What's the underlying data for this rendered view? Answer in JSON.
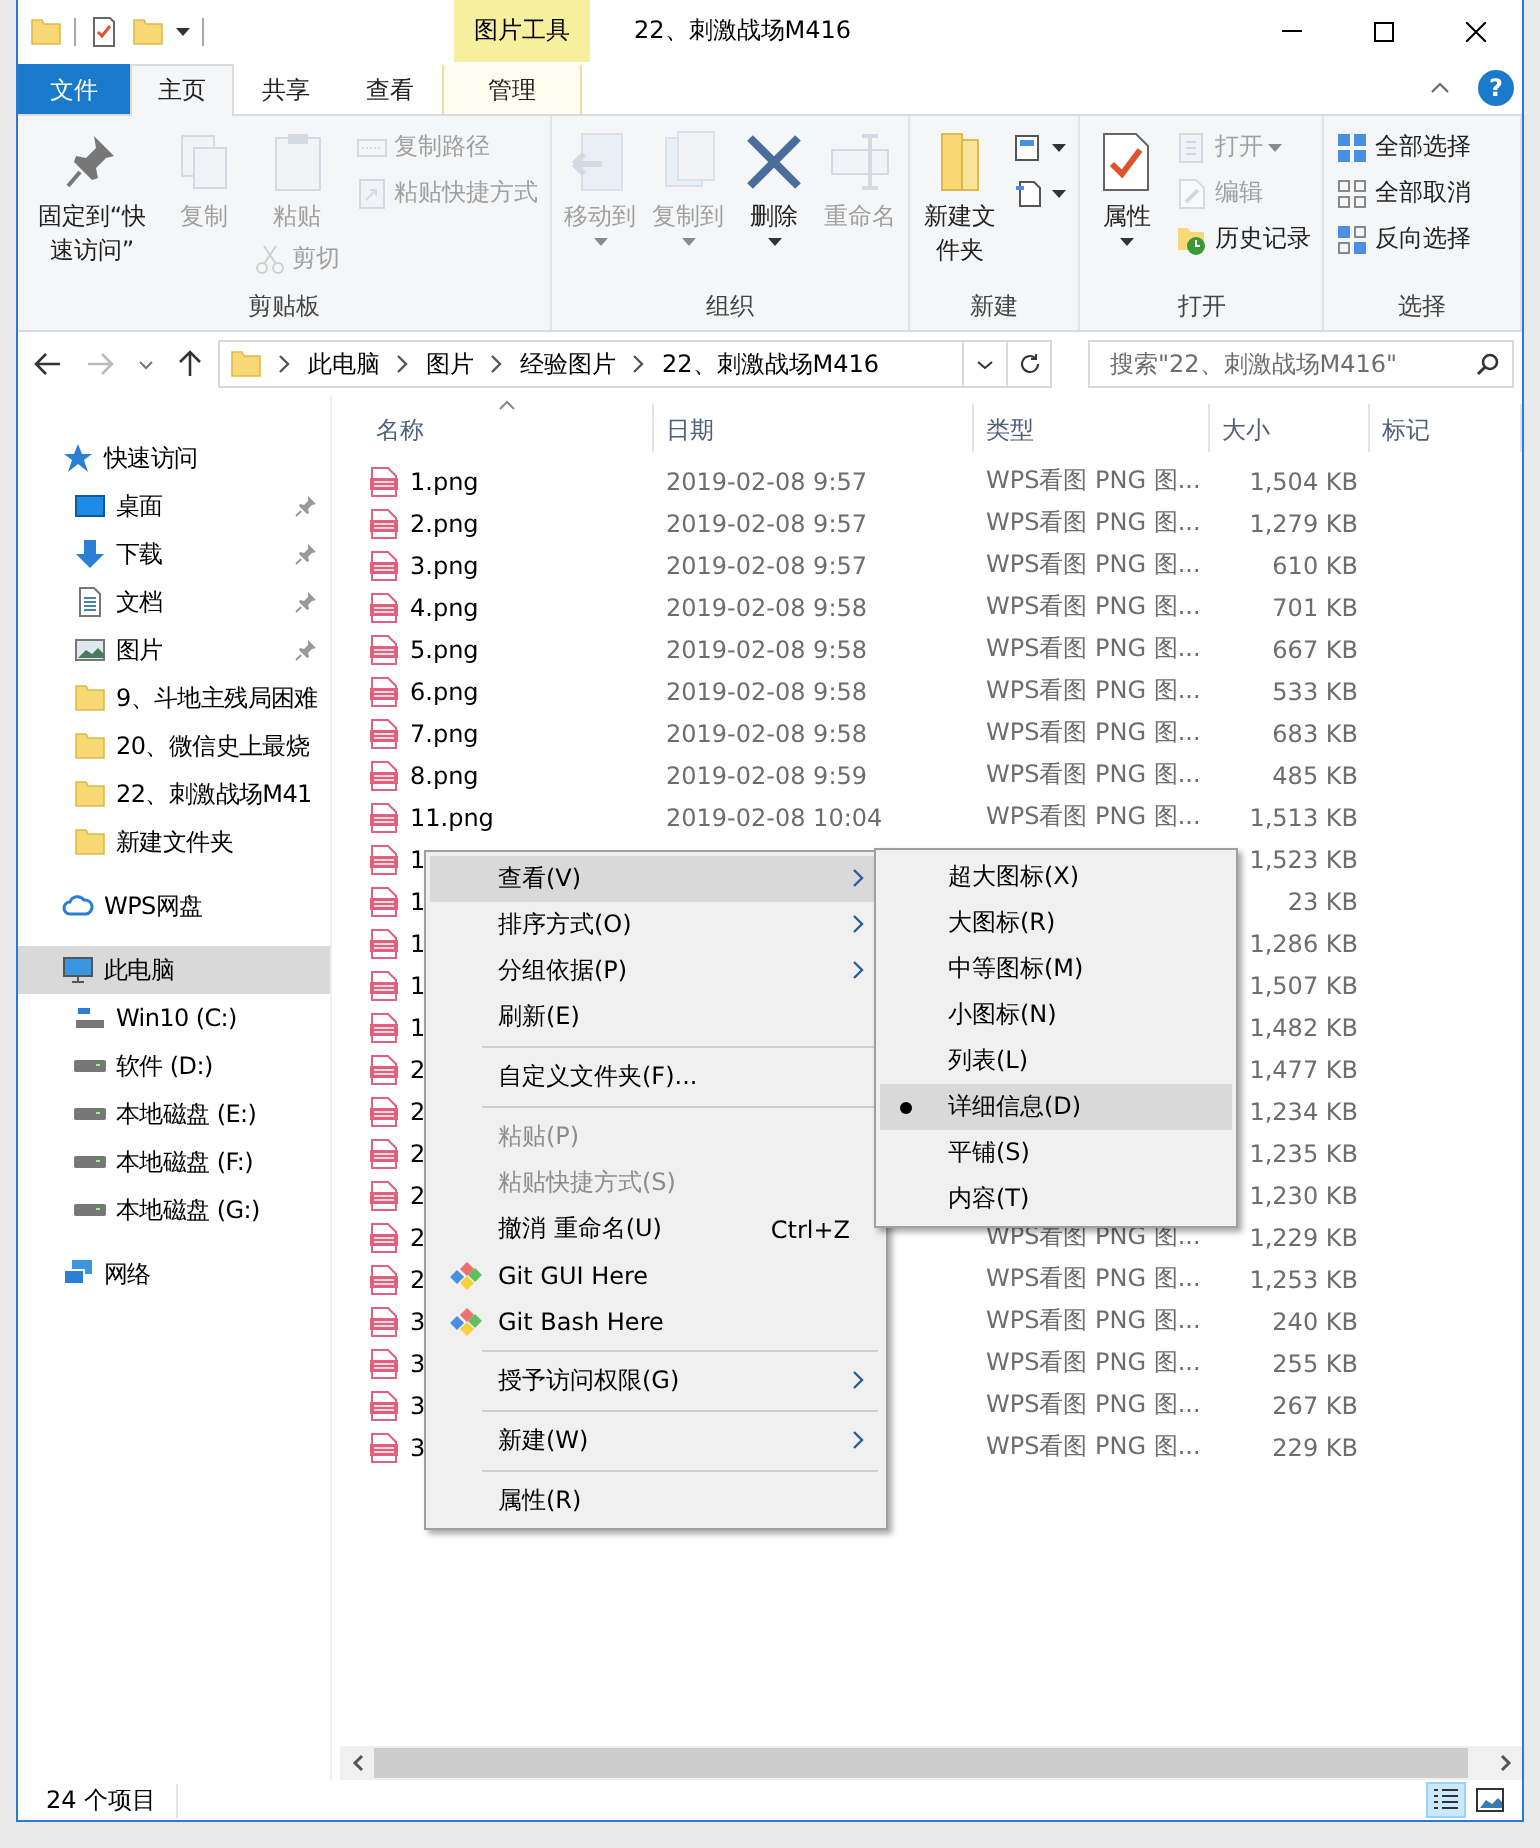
{
  "window": {
    "title": "22、刺激战场M416",
    "contextual_tab_group": "图片工具",
    "help": "?"
  },
  "ribbon_tabs": [
    {
      "label": "文件",
      "kind": "file",
      "selected": false
    },
    {
      "label": "主页",
      "kind": "tab",
      "selected": true
    },
    {
      "label": "共享",
      "kind": "tab",
      "selected": false
    },
    {
      "label": "查看",
      "kind": "tab",
      "selected": false
    },
    {
      "label": "管理",
      "kind": "contextual",
      "selected": false
    }
  ],
  "ribbon": {
    "groups": [
      {
        "label": "剪贴板",
        "items": [
          {
            "kind": "large",
            "label": "固定到“快速访问”",
            "disabled": false,
            "dropdown": false
          },
          {
            "kind": "large",
            "label": "复制",
            "disabled": true,
            "dropdown": false
          },
          {
            "kind": "large",
            "label": "粘贴",
            "disabled": true,
            "dropdown": false,
            "below": {
              "label": "剪切",
              "disabled": true
            }
          },
          {
            "kind": "column",
            "items": [
              {
                "label": "复制路径",
                "disabled": true,
                "dropdown": false
              },
              {
                "label": "粘贴快捷方式",
                "disabled": true,
                "dropdown": false
              }
            ]
          }
        ]
      },
      {
        "label": "组织",
        "items": [
          {
            "kind": "large",
            "label": "移动到",
            "disabled": true,
            "dropdown": true
          },
          {
            "kind": "large",
            "label": "复制到",
            "disabled": true,
            "dropdown": true
          },
          {
            "kind": "large",
            "label": "删除",
            "disabled": false,
            "dropdown": true
          },
          {
            "kind": "large",
            "label": "重命名",
            "disabled": true,
            "dropdown": false
          }
        ]
      },
      {
        "label": "新建",
        "items": [
          {
            "kind": "large",
            "label": "新建文件夹",
            "disabled": false,
            "dropdown": false
          },
          {
            "kind": "column",
            "items": [
              {
                "disabled": false,
                "dropdown": true
              },
              {
                "disabled": false,
                "dropdown": true
              }
            ]
          }
        ]
      },
      {
        "label": "打开",
        "items": [
          {
            "kind": "large",
            "label": "属性",
            "disabled": false,
            "dropdown": true
          },
          {
            "kind": "column",
            "items": [
              {
                "label": "打开",
                "disabled": true,
                "dropdown": true
              },
              {
                "label": "编辑",
                "disabled": true,
                "dropdown": false
              },
              {
                "label": "历史记录",
                "disabled": false,
                "dropdown": false
              }
            ]
          }
        ]
      },
      {
        "label": "选择",
        "items": [
          {
            "kind": "column",
            "items": [
              {
                "label": "全部选择",
                "disabled": false,
                "dropdown": false
              },
              {
                "label": "全部取消",
                "disabled": false,
                "dropdown": false
              },
              {
                "label": "反向选择",
                "disabled": false,
                "dropdown": false
              }
            ]
          }
        ]
      }
    ]
  },
  "address_bar": {
    "back_disabled": false,
    "forward_disabled": true,
    "crumbs": [
      "此电脑",
      "图片",
      "经验图片",
      "22、刺激战场M416"
    ]
  },
  "search": {
    "placeholder": "搜索\"22、刺激战场M416\""
  },
  "navigation": [
    {
      "label": "快速访问",
      "kind": "star",
      "selected": false,
      "children": [
        {
          "label": "桌面",
          "kind": "desktop",
          "pinned": true,
          "selected": false
        },
        {
          "label": "下载",
          "kind": "download",
          "pinned": true,
          "selected": false
        },
        {
          "label": "文档",
          "kind": "document",
          "pinned": true,
          "selected": false
        },
        {
          "label": "图片",
          "kind": "pictures",
          "pinned": true,
          "selected": false
        },
        {
          "label": "9、斗地主残局困难",
          "kind": "folder",
          "pinned": false,
          "selected": false
        },
        {
          "label": "20、微信史上最烧",
          "kind": "folder",
          "pinned": false,
          "selected": false
        },
        {
          "label": "22、刺激战场M41",
          "kind": "folder",
          "pinned": false,
          "selected": false
        },
        {
          "label": "新建文件夹",
          "kind": "folder",
          "pinned": false,
          "selected": false
        }
      ]
    },
    {
      "label": "WPS网盘",
      "kind": "cloud",
      "selected": false
    },
    {
      "label": "此电脑",
      "kind": "pc",
      "selected": true,
      "children": [
        {
          "label": "Win10 (C:)",
          "kind": "system-drive",
          "selected": false
        },
        {
          "label": "软件 (D:)",
          "kind": "drive",
          "selected": false
        },
        {
          "label": "本地磁盘 (E:)",
          "kind": "drive",
          "selected": false
        },
        {
          "label": "本地磁盘 (F:)",
          "kind": "drive",
          "selected": false
        },
        {
          "label": "本地磁盘 (G:)",
          "kind": "drive",
          "selected": false
        }
      ]
    },
    {
      "label": "网络",
      "kind": "network",
      "selected": false
    }
  ],
  "file_list": {
    "columns": [
      "名称",
      "日期",
      "类型",
      "大小",
      "标记"
    ],
    "rows": [
      {
        "name": "1.png",
        "date": "2019-02-08 9:57",
        "type": "WPS看图 PNG 图...",
        "size": "1,504 KB"
      },
      {
        "name": "2.png",
        "date": "2019-02-08 9:57",
        "type": "WPS看图 PNG 图...",
        "size": "1,279 KB"
      },
      {
        "name": "3.png",
        "date": "2019-02-08 9:57",
        "type": "WPS看图 PNG 图...",
        "size": "610 KB"
      },
      {
        "name": "4.png",
        "date": "2019-02-08 9:58",
        "type": "WPS看图 PNG 图...",
        "size": "701 KB"
      },
      {
        "name": "5.png",
        "date": "2019-02-08 9:58",
        "type": "WPS看图 PNG 图...",
        "size": "667 KB"
      },
      {
        "name": "6.png",
        "date": "2019-02-08 9:58",
        "type": "WPS看图 PNG 图...",
        "size": "533 KB"
      },
      {
        "name": "7.png",
        "date": "2019-02-08 9:58",
        "type": "WPS看图 PNG 图...",
        "size": "683 KB"
      },
      {
        "name": "8.png",
        "date": "2019-02-08 9:59",
        "type": "WPS看图 PNG 图...",
        "size": "485 KB"
      },
      {
        "name": "11.png",
        "date": "2019-02-08 10:04",
        "type": "WPS看图 PNG 图...",
        "size": "1,513 KB"
      },
      {
        "name": "1",
        "size": "1,523 KB"
      },
      {
        "name": "1",
        "size": "23 KB"
      },
      {
        "name": "1",
        "size": "1,286 KB"
      },
      {
        "name": "1",
        "size": "1,507 KB"
      },
      {
        "name": "1",
        "size": "1,482 KB"
      },
      {
        "name": "2",
        "size": "1,477 KB"
      },
      {
        "name": "2",
        "size": "1,234 KB"
      },
      {
        "name": "2",
        "size": "1,235 KB"
      },
      {
        "name": "2",
        "size": "1,230 KB"
      },
      {
        "name": "2",
        "type": "WPS看图 PNG 图...",
        "size": "1,229 KB"
      },
      {
        "name": "2",
        "type": "WPS看图 PNG 图...",
        "size": "1,253 KB"
      },
      {
        "name": "3",
        "type": "WPS看图 PNG 图...",
        "size": "240 KB"
      },
      {
        "name": "3",
        "type": "WPS看图 PNG 图...",
        "size": "255 KB"
      },
      {
        "name": "3",
        "type": "WPS看图 PNG 图...",
        "size": "267 KB"
      },
      {
        "name": "3",
        "type": "WPS看图 PNG 图...",
        "size": "229 KB"
      }
    ]
  },
  "context_menu": {
    "items": [
      {
        "kind": "item",
        "label": "查看(V)",
        "submenu": true,
        "disabled": false,
        "selected": true
      },
      {
        "kind": "item",
        "label": "排序方式(O)",
        "submenu": true,
        "disabled": false,
        "selected": false
      },
      {
        "kind": "item",
        "label": "分组依据(P)",
        "submenu": true,
        "disabled": false,
        "selected": false
      },
      {
        "kind": "item",
        "label": "刷新(E)",
        "submenu": false,
        "disabled": false,
        "selected": false
      },
      {
        "kind": "separator"
      },
      {
        "kind": "item",
        "label": "自定义文件夹(F)...",
        "submenu": false,
        "disabled": false,
        "selected": false
      },
      {
        "kind": "separator"
      },
      {
        "kind": "item",
        "label": "粘贴(P)",
        "submenu": false,
        "disabled": true,
        "selected": false
      },
      {
        "kind": "item",
        "label": "粘贴快捷方式(S)",
        "submenu": false,
        "disabled": true,
        "selected": false
      },
      {
        "kind": "item",
        "label": "撤消 重命名(U)",
        "shortcut": "Ctrl+Z",
        "submenu": false,
        "disabled": false,
        "selected": false
      },
      {
        "kind": "git",
        "label": "Git GUI Here",
        "submenu": false,
        "disabled": false,
        "selected": false
      },
      {
        "kind": "git",
        "label": "Git Bash Here",
        "submenu": false,
        "disabled": false,
        "selected": false
      },
      {
        "kind": "separator"
      },
      {
        "kind": "item",
        "label": "授予访问权限(G)",
        "submenu": true,
        "disabled": false,
        "selected": false
      },
      {
        "kind": "separator"
      },
      {
        "kind": "item",
        "label": "新建(W)",
        "submenu": true,
        "disabled": false,
        "selected": false
      },
      {
        "kind": "separator"
      },
      {
        "kind": "item",
        "label": "属性(R)",
        "submenu": false,
        "disabled": false,
        "selected": false
      }
    ]
  },
  "view_submenu": {
    "items": [
      {
        "label": "超大图标(X)",
        "checked": false,
        "selected": false
      },
      {
        "label": "大图标(R)",
        "checked": false,
        "selected": false
      },
      {
        "label": "中等图标(M)",
        "checked": false,
        "selected": false
      },
      {
        "label": "小图标(N)",
        "checked": false,
        "selected": false
      },
      {
        "label": "列表(L)",
        "checked": false,
        "selected": false
      },
      {
        "label": "详细信息(D)",
        "checked": true,
        "selected": true
      },
      {
        "label": "平铺(S)",
        "checked": false,
        "selected": false
      },
      {
        "label": "内容(T)",
        "checked": false,
        "selected": false
      }
    ]
  },
  "status_bar": {
    "item_count": "24 个项目",
    "views": [
      {
        "kind": "details",
        "selected": true
      },
      {
        "kind": "large-icons",
        "selected": false
      }
    ]
  }
}
